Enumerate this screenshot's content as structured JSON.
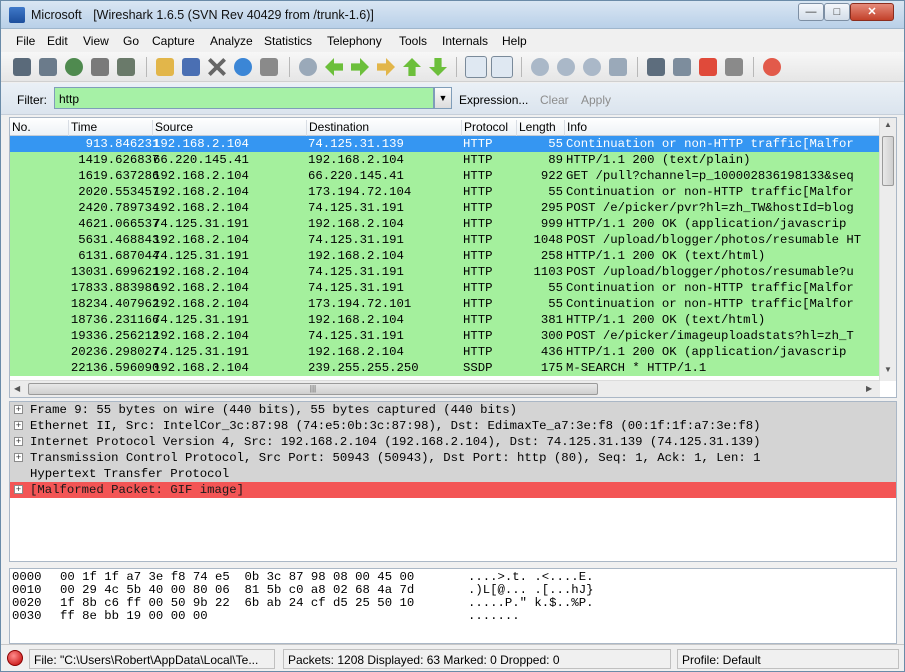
{
  "window": {
    "app_name": "Microsoft",
    "title": "[Wireshark 1.6.5  (SVN Rev 40429 from /trunk-1.6)]",
    "minimize": "—",
    "maximize": "□",
    "close": "✕"
  },
  "menu": [
    "File",
    "Edit",
    "View",
    "Go",
    "Capture",
    "Analyze",
    "Statistics",
    "Telephony",
    "Tools",
    "Internals",
    "Help"
  ],
  "filter": {
    "label": "Filter:",
    "value": "http",
    "expression_label": "Expression...",
    "clear_label": "Clear",
    "apply_label": "Apply",
    "field_color": "#a6f1a6"
  },
  "packet_list": {
    "columns": [
      "No.",
      "Time",
      "Source",
      "Destination",
      "Protocol",
      "Length",
      "Info"
    ],
    "rows": [
      {
        "no": "9",
        "time": "13.846231",
        "src": "192.168.2.104",
        "dst": "74.125.31.139",
        "proto": "HTTP",
        "len": "55",
        "info": "Continuation or non-HTTP traffic[Malfor",
        "selected": true
      },
      {
        "no": "14",
        "time": "19.626837",
        "src": "66.220.145.41",
        "dst": "192.168.2.104",
        "proto": "HTTP",
        "len": "89",
        "info": "HTTP/1.1 200   (text/plain)"
      },
      {
        "no": "16",
        "time": "19.637286",
        "src": "192.168.2.104",
        "dst": "66.220.145.41",
        "proto": "HTTP",
        "len": "922",
        "info": "GET /pull?channel=p_100002836198133&seq"
      },
      {
        "no": "20",
        "time": "20.553457",
        "src": "192.168.2.104",
        "dst": "173.194.72.104",
        "proto": "HTTP",
        "len": "55",
        "info": "Continuation or non-HTTP traffic[Malfor"
      },
      {
        "no": "24",
        "time": "20.789734",
        "src": "192.168.2.104",
        "dst": "74.125.31.191",
        "proto": "HTTP",
        "len": "295",
        "info": "POST /e/picker/pvr?hl=zh_TW&hostId=blog"
      },
      {
        "no": "46",
        "time": "21.066537",
        "src": "74.125.31.191",
        "dst": "192.168.2.104",
        "proto": "HTTP",
        "len": "999",
        "info": "HTTP/1.1 200 OK  (application/javascrip"
      },
      {
        "no": "56",
        "time": "31.468843",
        "src": "192.168.2.104",
        "dst": "74.125.31.191",
        "proto": "HTTP",
        "len": "1048",
        "info": "POST /upload/blogger/photos/resumable HT"
      },
      {
        "no": "61",
        "time": "31.687044",
        "src": "74.125.31.191",
        "dst": "192.168.2.104",
        "proto": "HTTP",
        "len": "258",
        "info": "HTTP/1.1 200 OK  (text/html)"
      },
      {
        "no": "130",
        "time": "31.699621",
        "src": "192.168.2.104",
        "dst": "74.125.31.191",
        "proto": "HTTP",
        "len": "1103",
        "info": "POST /upload/blogger/photos/resumable?u"
      },
      {
        "no": "178",
        "time": "33.883986",
        "src": "192.168.2.104",
        "dst": "74.125.31.191",
        "proto": "HTTP",
        "len": "55",
        "info": "Continuation or non-HTTP traffic[Malfor"
      },
      {
        "no": "182",
        "time": "34.407962",
        "src": "192.168.2.104",
        "dst": "173.194.72.101",
        "proto": "HTTP",
        "len": "55",
        "info": "Continuation or non-HTTP traffic[Malfor"
      },
      {
        "no": "187",
        "time": "36.231166",
        "src": "74.125.31.191",
        "dst": "192.168.2.104",
        "proto": "HTTP",
        "len": "381",
        "info": "HTTP/1.1 200 OK  (text/html)"
      },
      {
        "no": "193",
        "time": "36.256212",
        "src": "192.168.2.104",
        "dst": "74.125.31.191",
        "proto": "HTTP",
        "len": "300",
        "info": "POST /e/picker/imageuploadstats?hl=zh_T"
      },
      {
        "no": "202",
        "time": "36.298027",
        "src": "74.125.31.191",
        "dst": "192.168.2.104",
        "proto": "HTTP",
        "len": "436",
        "info": "HTTP/1.1 200 OK  (application/javascrip"
      },
      {
        "no": "221",
        "time": "36.596090",
        "src": "192.168.2.104",
        "dst": "239.255.255.250",
        "proto": "SSDP",
        "len": "175",
        "info": "M-SEARCH * HTTP/1.1"
      }
    ],
    "row_color": "#a4f09d",
    "selected_color": "#3596f2"
  },
  "details": [
    {
      "text": "Frame 9: 55 bytes on wire (440 bits), 55 bytes captured (440 bits)",
      "expand": "+"
    },
    {
      "text": "Ethernet II, Src: IntelCor_3c:87:98 (74:e5:0b:3c:87:98), Dst: EdimaxTe_a7:3e:f8 (00:1f:1f:a7:3e:f8)",
      "expand": "+"
    },
    {
      "text": "Internet Protocol Version 4, Src: 192.168.2.104 (192.168.2.104), Dst: 74.125.31.139 (74.125.31.139)",
      "expand": "+"
    },
    {
      "text": "Transmission Control Protocol, Src Port: 50943 (50943), Dst Port: http (80), Seq: 1, Ack: 1, Len: 1",
      "expand": "+"
    },
    {
      "text": "Hypertext Transfer Protocol",
      "expand": ""
    },
    {
      "text": "[Malformed Packet: GIF image]",
      "expand": "+",
      "malformed": true
    }
  ],
  "hex": [
    {
      "offset": "0000",
      "bytes": "00 1f 1f a7 3e f8 74 e5  0b 3c 87 98 08 00 45 00",
      "ascii": "....>.t. .<....E."
    },
    {
      "offset": "0010",
      "bytes": "00 29 4c 5b 40 00 80 06  81 5b c0 a8 02 68 4a 7d",
      "ascii": ".)L[@... .[...hJ}"
    },
    {
      "offset": "0020",
      "bytes": "1f 8b c6 ff 00 50 9b 22  6b ab 24 cf d5 25 50 10",
      "ascii": ".....P.\" k.$..%P."
    },
    {
      "offset": "0030",
      "bytes": "ff 8e bb 19 00 00 00",
      "ascii": "......."
    }
  ],
  "status": {
    "file": "File: \"C:\\Users\\Robert\\AppData\\Local\\Te...",
    "packets": "Packets: 1208 Displayed: 63 Marked: 0 Dropped: 0",
    "profile": "Profile: Default"
  }
}
